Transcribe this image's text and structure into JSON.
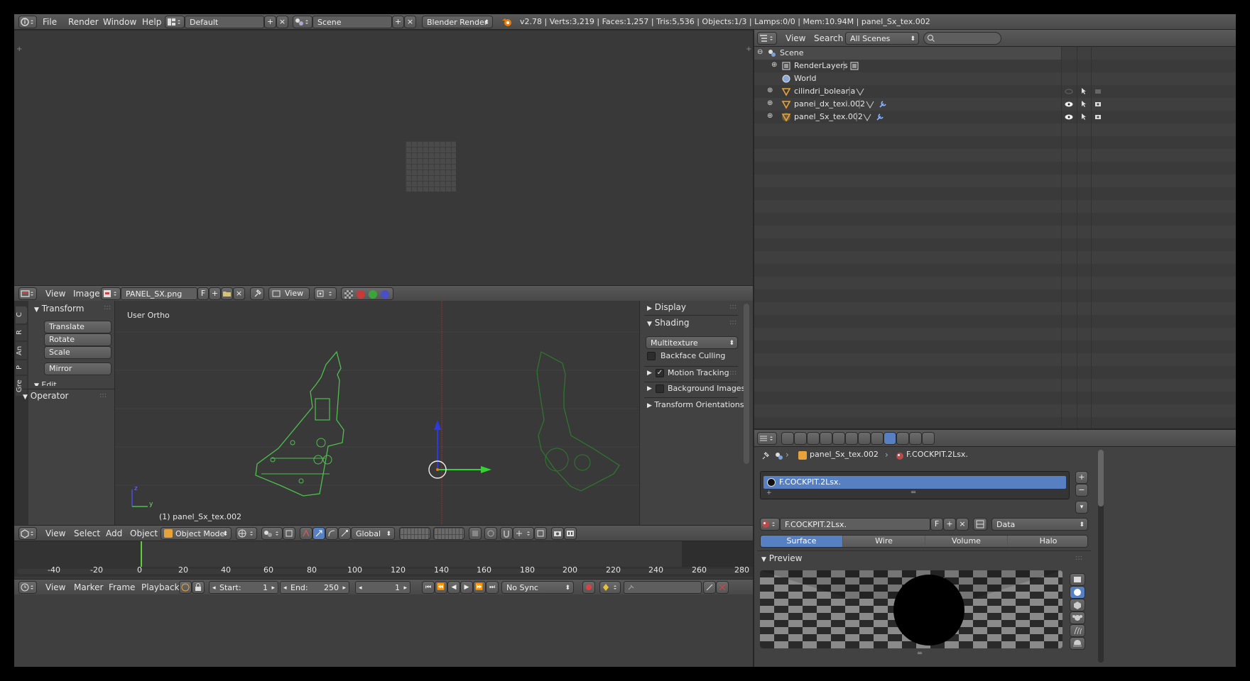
{
  "top_menu": {
    "items": [
      "File",
      "Render",
      "Window",
      "Help"
    ],
    "layout": "Default",
    "scene": "Scene",
    "engine": "Blender Render",
    "status": "v2.78 | Verts:3,219 | Faces:1,257 | Tris:5,536 | Objects:1/3 | Lamps:0/0 | Mem:10.94M | panel_Sx_tex.002"
  },
  "image_editor_header": {
    "menus": [
      "View",
      "Image"
    ],
    "image_name": "PANEL_SX.png",
    "fake_user": "F",
    "view_label": "View"
  },
  "viewport": {
    "view_label": "User Ortho",
    "object_label": "(1) panel_Sx_tex.002",
    "axis_z": "z",
    "axis_y": "y"
  },
  "tool_shelf": {
    "tabs": [
      "C",
      "R",
      "An",
      "P",
      "Gre"
    ],
    "panel_transform": "Transform",
    "buttons": [
      "Translate",
      "Rotate",
      "Scale",
      "Mirror"
    ],
    "panel_edit": "Edit",
    "panel_operator": "Operator"
  },
  "properties_n": {
    "display": "Display",
    "shading": "Shading",
    "shading_mode": "Multitexture",
    "backface_culling": "Backface Culling",
    "motion_tracking": "Motion Tracking",
    "background_images": "Background Images",
    "transform_orientations": "Transform Orientations"
  },
  "view3d_header": {
    "menus": [
      "View",
      "Select",
      "Add",
      "Object"
    ],
    "mode": "Object Mode",
    "orientation": "Global"
  },
  "timeline": {
    "ticks": [
      "-40",
      "-20",
      "0",
      "20",
      "40",
      "60",
      "80",
      "100",
      "120",
      "140",
      "160",
      "180",
      "200",
      "220",
      "240",
      "260",
      "280"
    ],
    "menus": [
      "View",
      "Marker",
      "Frame",
      "Playback"
    ],
    "start_label": "Start:",
    "start": "1",
    "end_label": "End:",
    "end": "250",
    "current": "1",
    "sync": "No Sync"
  },
  "outliner": {
    "menus": [
      "View",
      "Search"
    ],
    "filter": "All Scenes",
    "items": [
      {
        "label": "Scene"
      },
      {
        "label": "RenderLayers"
      },
      {
        "label": "World"
      },
      {
        "label": "cilindri_boleana"
      },
      {
        "label": "panei_dx_texi.002"
      },
      {
        "label": "panel_Sx_tex.002"
      }
    ]
  },
  "material_panel": {
    "breadcrumb_object": "panel_Sx_tex.002",
    "breadcrumb_material": "F.COCKPIT.2Lsx.",
    "slot_name": "F.COCKPIT.2Lsx.",
    "material_name": "F.COCKPIT.2Lsx.",
    "fake_user": "F",
    "link": "Data",
    "tabs": [
      "Surface",
      "Wire",
      "Volume",
      "Halo"
    ],
    "preview_label": "Preview"
  },
  "colors": {
    "accent": "#5680c2",
    "curve_green": "#4fbf4f",
    "axis_blue": "#2e3ae0",
    "axis_green": "#2ed62e",
    "axis_red": "#c23232"
  }
}
